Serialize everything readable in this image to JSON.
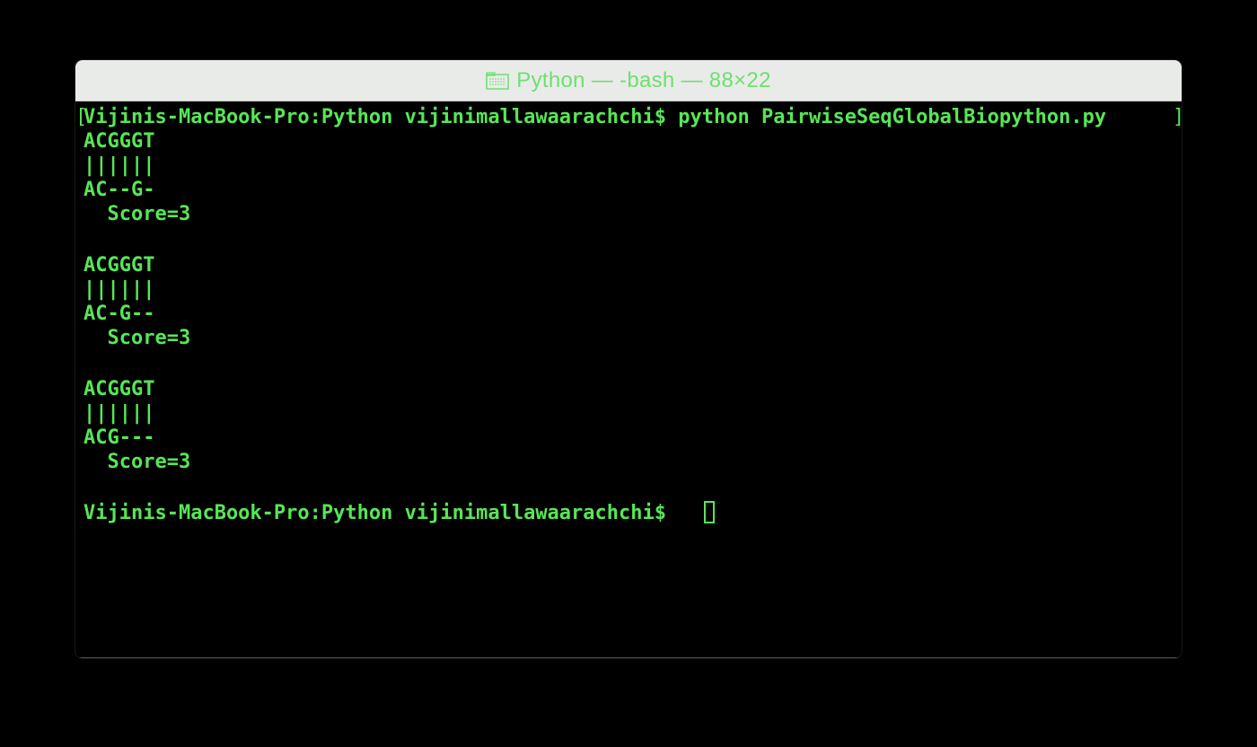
{
  "window": {
    "title": "Python — -bash — 88×22",
    "title_icon": "folder-icon"
  },
  "terminal": {
    "command_line": "Vijinis-MacBook-Pro:Python vijinimallawaarachchi$ python PairwiseSeqGlobalBiopython.py",
    "output": [
      "ACGGGT",
      "||||||",
      "AC--G-",
      "  Score=3",
      "",
      "ACGGGT",
      "||||||",
      "AC-G--",
      "  Score=3",
      "",
      "ACGGGT",
      "||||||",
      "ACG---",
      "  Score=3",
      ""
    ],
    "prompt": "Vijinis-MacBook-Pro:Python vijinimallawaarachchi$ "
  },
  "colors": {
    "text": "#57e657",
    "background": "#000000",
    "titlebar": "#e9ebe9"
  }
}
